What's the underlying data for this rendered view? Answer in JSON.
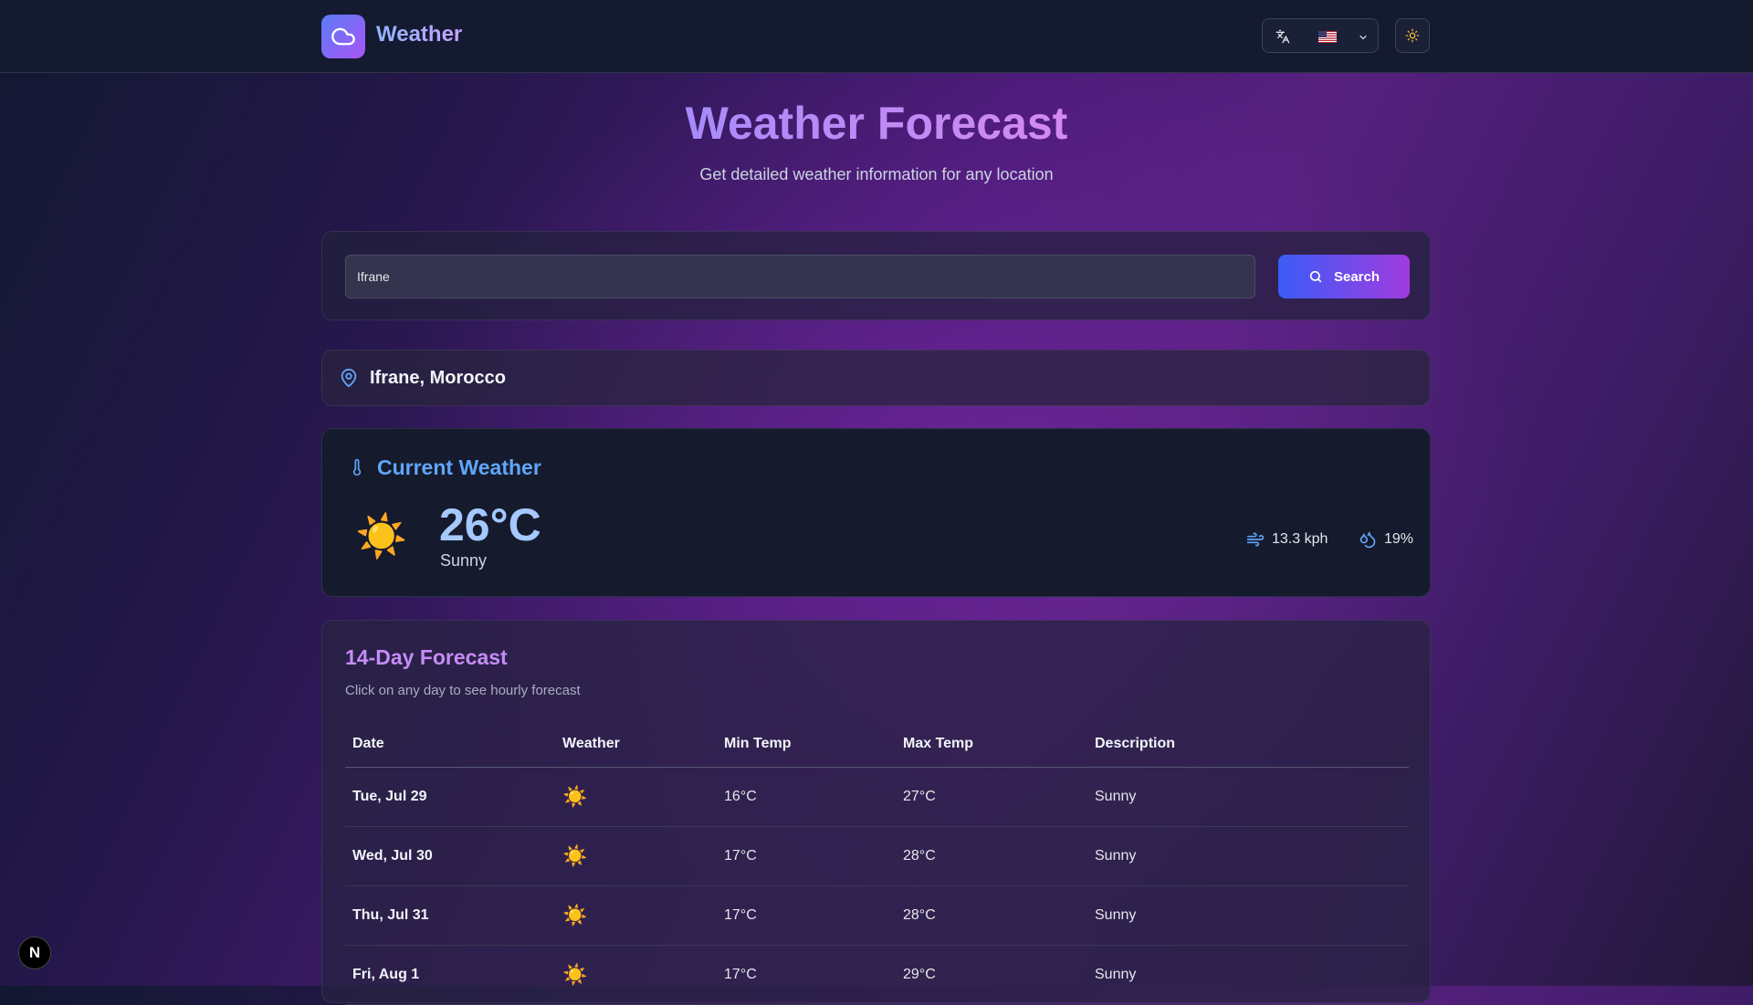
{
  "header": {
    "app_title": "Weather",
    "logo_icon": "cloud-icon",
    "language_icon": "translate-icon",
    "language_flag": "us-flag",
    "theme_icon": "sun-icon"
  },
  "hero": {
    "title": "Weather Forecast",
    "subtitle": "Get detailed weather information for any location"
  },
  "search": {
    "value": "Ifrane",
    "button_label": "Search"
  },
  "location": {
    "name": "Ifrane, Morocco"
  },
  "current": {
    "title": "Current Weather",
    "temperature": "26°C",
    "condition": "Sunny",
    "condition_icon": "☀️",
    "wind": "13.3 kph",
    "humidity": "19%"
  },
  "forecast": {
    "title": "14-Day Forecast",
    "subtitle": "Click on any day to see hourly forecast",
    "columns": [
      "Date",
      "Weather",
      "Min Temp",
      "Max Temp",
      "Description"
    ],
    "rows": [
      {
        "date": "Tue, Jul 29",
        "icon": "☀️",
        "min": "16°C",
        "max": "27°C",
        "desc": "Sunny"
      },
      {
        "date": "Wed, Jul 30",
        "icon": "☀️",
        "min": "17°C",
        "max": "28°C",
        "desc": "Sunny"
      },
      {
        "date": "Thu, Jul 31",
        "icon": "☀️",
        "min": "17°C",
        "max": "28°C",
        "desc": "Sunny"
      },
      {
        "date": "Fri, Aug 1",
        "icon": "☀️",
        "min": "17°C",
        "max": "29°C",
        "desc": "Sunny"
      }
    ]
  },
  "badge": {
    "label": "N"
  },
  "colors": {
    "accent_blue": "#60a5fa",
    "accent_purple": "#c58cf5",
    "header_bg": "#141a30"
  }
}
